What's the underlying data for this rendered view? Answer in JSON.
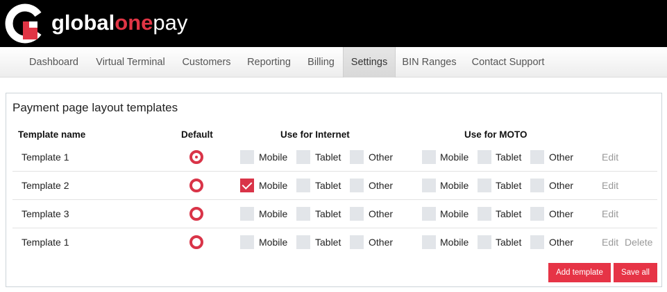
{
  "brand": {
    "part1": "global",
    "part2": "one",
    "part3": "pay",
    "accent_color": "#e03545"
  },
  "nav": {
    "items": [
      {
        "label": "Dashboard",
        "active": false
      },
      {
        "label": "Virtual Terminal",
        "active": false
      },
      {
        "label": "Customers",
        "active": false
      },
      {
        "label": "Reporting",
        "active": false
      },
      {
        "label": "Billing",
        "active": false
      },
      {
        "label": "Settings",
        "active": true
      },
      {
        "label": "BIN Ranges",
        "active": false
      },
      {
        "label": "Contact Support",
        "active": false
      }
    ]
  },
  "panel": {
    "title": "Payment page layout templates",
    "headers": {
      "name": "Template name",
      "default": "Default",
      "internet": "Use for Internet",
      "moto": "Use for MOTO"
    },
    "channel_labels": [
      "Mobile",
      "Tablet",
      "Other"
    ],
    "rows": [
      {
        "name": "Template 1",
        "is_default": true,
        "internet": [
          false,
          false,
          false
        ],
        "moto": [
          false,
          false,
          false
        ],
        "edit": "Edit",
        "delete": ""
      },
      {
        "name": "Template 2",
        "is_default": false,
        "internet": [
          true,
          false,
          false
        ],
        "moto": [
          false,
          false,
          false
        ],
        "edit": "Edit",
        "delete": ""
      },
      {
        "name": "Template 3",
        "is_default": false,
        "internet": [
          false,
          false,
          false
        ],
        "moto": [
          false,
          false,
          false
        ],
        "edit": "Edit",
        "delete": ""
      },
      {
        "name": "Template 1",
        "is_default": false,
        "internet": [
          false,
          false,
          false
        ],
        "moto": [
          false,
          false,
          false
        ],
        "edit": "Edit",
        "delete": "Delete"
      }
    ],
    "buttons": {
      "add": "Add template",
      "save": "Save all"
    }
  },
  "colors": {
    "accent": "#d93448",
    "checkbox_empty": "#e2e5e9",
    "link": "#999999"
  }
}
